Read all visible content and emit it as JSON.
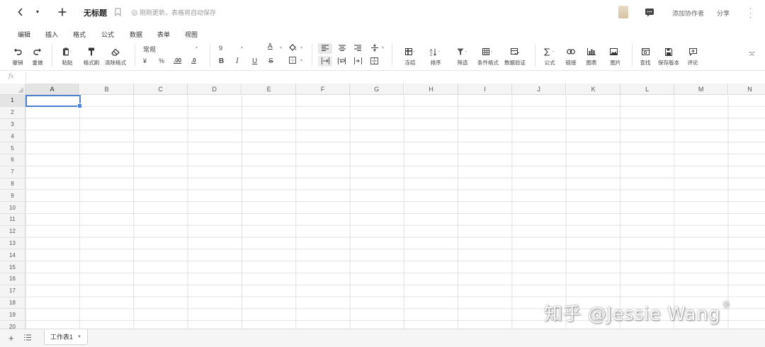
{
  "header": {
    "title": "无标题",
    "save_status": "刚刚更新，表格将自动保存",
    "add_collaborator": "添加协作者",
    "share": "分享"
  },
  "menu": [
    "编辑",
    "插入",
    "格式",
    "公式",
    "数据",
    "表单",
    "视图"
  ],
  "toolbar": {
    "undo": "撤销",
    "redo": "重做",
    "paste": "粘贴",
    "format_painter": "格式刷",
    "clear_format": "清除格式",
    "number_format": "常规",
    "currency": "¥",
    "percent": "%",
    "dec_inc": ".00",
    "dec_dec": ".0",
    "font_size": "9",
    "bold": "B",
    "italic": "I",
    "underline": "U",
    "strike": "S",
    "font_color_glyph": "A",
    "freeze": "冻结",
    "sort": "排序",
    "filter": "筛选",
    "conditional_format": "条件格式",
    "data_validation": "数据验证",
    "formula": "公式",
    "link": "链接",
    "chart": "图表",
    "image": "图片",
    "find": "查找",
    "save_version": "保存版本",
    "comment": "评论"
  },
  "formula_bar": {
    "fx": "fx",
    "value": ""
  },
  "grid": {
    "columns": [
      "A",
      "B",
      "C",
      "D",
      "E",
      "F",
      "G",
      "H",
      "I",
      "J",
      "K",
      "L",
      "M",
      "N"
    ],
    "rows": [
      "1",
      "2",
      "3",
      "4",
      "5",
      "6",
      "7",
      "8",
      "9",
      "10",
      "11",
      "12",
      "13",
      "14",
      "15",
      "16",
      "17",
      "18",
      "19",
      "20"
    ],
    "active_cell": "A1",
    "selection_color": "#4a7fd1"
  },
  "sheets": [
    {
      "name": "工作表1",
      "active": true
    }
  ],
  "watermark": "知乎 @Jessie Wang"
}
